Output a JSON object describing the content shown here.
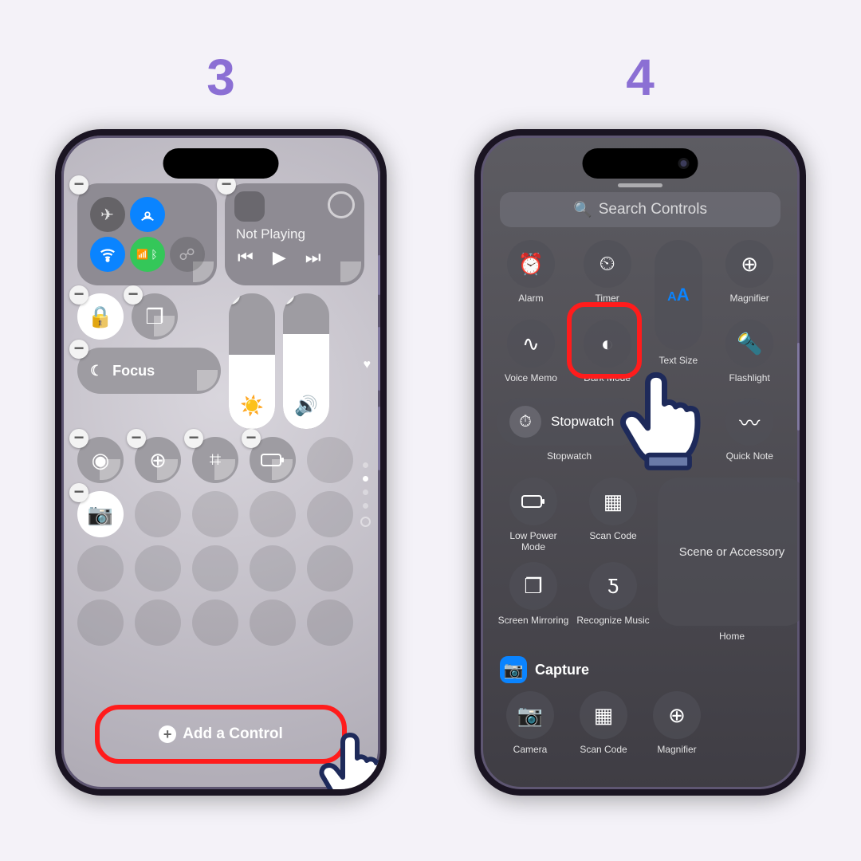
{
  "steps": {
    "left": "3",
    "right": "4"
  },
  "colors": {
    "accent": "#8b6fd4",
    "highlight": "#ff1c1c",
    "ios_blue": "#0a84ff",
    "ios_green": "#34c759"
  },
  "screen_left": {
    "connectivity_icons": [
      "airplane-icon",
      "airdrop-icon",
      "wifi-icon",
      "cellular-icon",
      "bluetooth-icon",
      "personal-hotspot-icon"
    ],
    "now_playing": "Not Playing",
    "focus_label": "Focus",
    "brightness_percent": 55,
    "volume_percent": 70,
    "controls_row": [
      "screen-record-icon",
      "magnifier-icon",
      "calculator-icon",
      "battery-icon"
    ],
    "extra_control": "camera-icon",
    "add_button": "Add a Control",
    "side_indicator": {
      "love": "♥"
    }
  },
  "screen_right": {
    "search_placeholder": "Search Controls",
    "row1": [
      {
        "icon": "alarm-icon",
        "label": "Alarm"
      },
      {
        "icon": "timer-icon",
        "label": "Timer"
      },
      {
        "label": ""
      },
      {
        "icon": "magnifier-icon",
        "label": "Magnifier"
      }
    ],
    "row2": [
      {
        "icon": "voice-memo-icon",
        "label": "Voice Memo"
      },
      {
        "icon": "dark-mode-icon",
        "label": "Dark Mode"
      },
      {
        "icon": "text-size-icon",
        "label": "Text Size",
        "text": "AA"
      },
      {
        "icon": "flashlight-icon",
        "label": "Flashlight"
      }
    ],
    "stopwatch_wide": "Stopwatch",
    "stopwatch_label": "Stopwatch",
    "row3_right": [
      {
        "icon": "screen-record-icon",
        "label": ""
      },
      {
        "icon": "quick-note-icon",
        "label": "Quick Note"
      }
    ],
    "row4": [
      {
        "icon": "low-power-icon",
        "label": "Low Power Mode"
      },
      {
        "icon": "scan-code-icon",
        "label": "Scan Code"
      }
    ],
    "row5": [
      {
        "icon": "screen-mirroring-icon",
        "label": "Screen Mirroring"
      },
      {
        "icon": "recognize-music-icon",
        "label": "Recognize Music"
      }
    ],
    "home_box": {
      "top": "Scene or Accessory",
      "bottom": "Home"
    },
    "capture_section": "Capture",
    "capture_row": [
      {
        "icon": "camera-icon",
        "label": "Camera"
      },
      {
        "icon": "scan-code-icon",
        "label": "Scan Code"
      },
      {
        "icon": "magnifier-icon",
        "label": "Magnifier"
      }
    ]
  }
}
